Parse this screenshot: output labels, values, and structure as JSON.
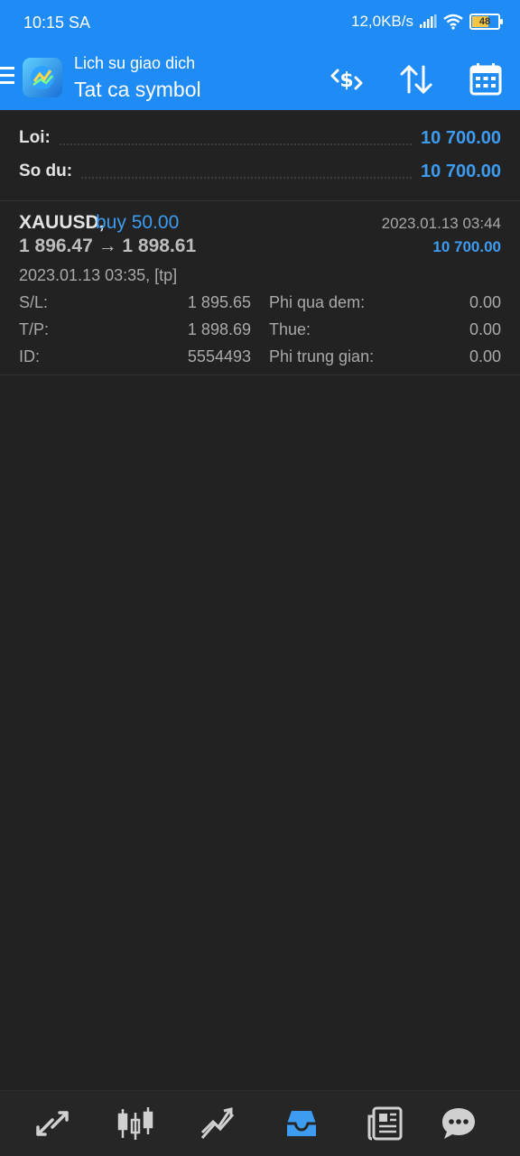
{
  "status_bar": {
    "time": "10:15 SA",
    "network_speed": "12,0KB/s",
    "battery": "48"
  },
  "app_bar": {
    "subtitle": "Lich su giao dich",
    "title": "Tat ca symbol",
    "actions": [
      "currency-exchange-icon",
      "sort-icon",
      "calendar-icon"
    ]
  },
  "summary": {
    "profit_label": "Loi:",
    "profit_value": "10 700.00",
    "balance_label": "So du:",
    "balance_value": "10 700.00"
  },
  "trade": {
    "symbol": "XAUUSD,",
    "side": "buy 50.00",
    "close_time": "2023.01.13 03:44",
    "prices": "1 896.47 → 1 898.61",
    "profit": "10 700.00",
    "open_info": "2023.01.13 03:35, [tp]",
    "sl_label": "S/L:",
    "sl_value": "1 895.65",
    "tp_label": "T/P:",
    "tp_value": "1 898.69",
    "id_label": "ID:",
    "id_value": "5554493",
    "swap_label": "Phi qua dem:",
    "swap_value": "0.00",
    "tax_label": "Thue:",
    "tax_value": "0.00",
    "commission_label": "Phi trung gian:",
    "commission_value": "0.00"
  },
  "bottom_nav": {
    "items": [
      "quotes-icon",
      "chart-icon",
      "trade-icon",
      "history-icon",
      "news-icon",
      "chat-icon"
    ],
    "active": "history-icon"
  },
  "colors": {
    "accent": "#1f8cf5",
    "value_blue": "#3d9bf0",
    "background": "#222222"
  }
}
